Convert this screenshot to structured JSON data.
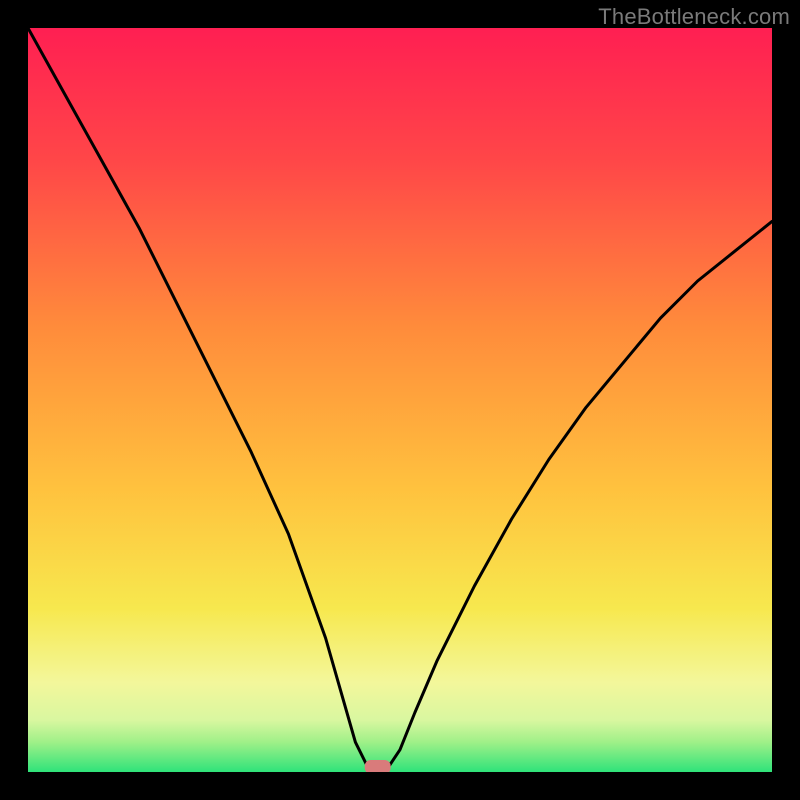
{
  "watermark": "TheBottleneck.com",
  "chart_data": {
    "type": "line",
    "title": "",
    "xlabel": "",
    "ylabel": "",
    "xlim": [
      0,
      100
    ],
    "ylim": [
      0,
      100
    ],
    "grid": false,
    "legend": false,
    "series": [
      {
        "name": "bottleneck-curve",
        "x": [
          0,
          5,
          10,
          15,
          20,
          25,
          30,
          35,
          40,
          42,
          44,
          46,
          47,
          48,
          50,
          52,
          55,
          60,
          65,
          70,
          75,
          80,
          85,
          90,
          95,
          100
        ],
        "y": [
          100,
          91,
          82,
          73,
          63,
          53,
          43,
          32,
          18,
          11,
          4,
          0,
          0,
          0,
          3,
          8,
          15,
          25,
          34,
          42,
          49,
          55,
          61,
          66,
          70,
          74
        ]
      }
    ],
    "annotations": [
      {
        "type": "marker",
        "shape": "rounded-rect",
        "x": 47,
        "y": 0,
        "color": "#d97b7b"
      }
    ],
    "bands": [
      {
        "y0": 0,
        "y1": 3,
        "role": "best",
        "color": "#2fe37a"
      },
      {
        "y0": 3,
        "y1": 6,
        "role": "good",
        "color": "#cdf59a"
      },
      {
        "y0": 6,
        "y1": 20,
        "role": "ok",
        "color": "#f3f79b"
      },
      {
        "y0": 20,
        "y1": 70,
        "role": "warn",
        "color_from": "#f8e84a",
        "color_to": "#ff7a3c"
      },
      {
        "y0": 70,
        "y1": 100,
        "role": "bad",
        "color_from": "#ff6a3a",
        "color_to": "#ff1f52"
      }
    ]
  }
}
